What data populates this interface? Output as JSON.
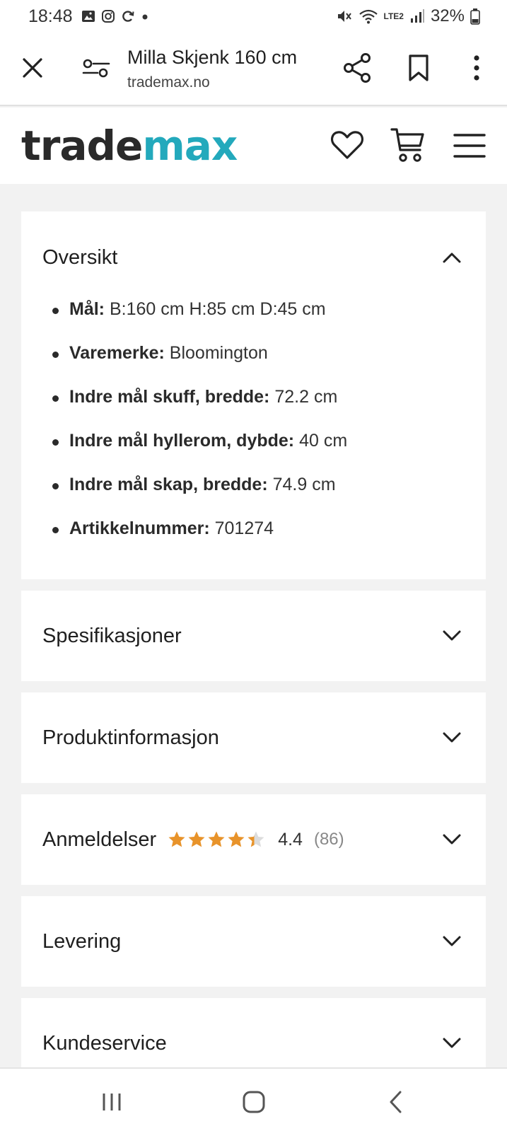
{
  "status_bar": {
    "time": "18:48",
    "battery": "32%",
    "network": "LTE2",
    "notification_icons": [
      "gallery-icon",
      "instagram-icon",
      "sync-icon",
      "dot-icon"
    ]
  },
  "browser": {
    "page_title": "Milla Skjenk 160 cm",
    "url": "trademax.no"
  },
  "site": {
    "logo_part1": "trade",
    "logo_part2": "max",
    "accent_color": "#23a9bc"
  },
  "overview": {
    "title": "Oversikt",
    "items": [
      {
        "label": "Mål:",
        "value": "B:160 cm H:85 cm D:45 cm"
      },
      {
        "label": "Varemerke:",
        "value": "Bloomington"
      },
      {
        "label": "Indre mål skuff, bredde:",
        "value": "72.2 cm"
      },
      {
        "label": "Indre mål hyllerom, dybde:",
        "value": "40 cm"
      },
      {
        "label": "Indre mål skap, bredde:",
        "value": "74.9 cm"
      },
      {
        "label": "Artikkelnummer:",
        "value": "701274"
      }
    ]
  },
  "sections": {
    "specifications": "Spesifikasjoner",
    "product_info": "Produktinformasjon",
    "reviews": "Anmeldelser",
    "delivery": "Levering",
    "customer_service": "Kundeservice"
  },
  "reviews": {
    "rating": "4.4",
    "count": "(86)",
    "stars_value": 4.4,
    "star_color": "#e8932a"
  }
}
